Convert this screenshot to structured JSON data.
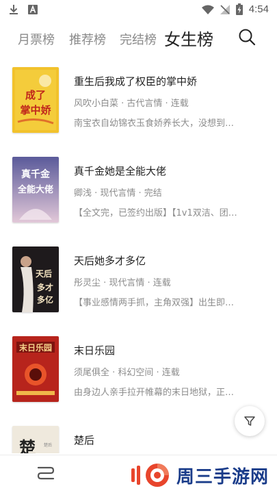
{
  "status_bar": {
    "time": "4:54",
    "icons": [
      "download-icon",
      "font-app-icon",
      "wifi-icon",
      "no-signal-icon",
      "battery-charging-icon"
    ]
  },
  "tabs": [
    {
      "label": "月票榜",
      "active": false
    },
    {
      "label": "推荐榜",
      "active": false
    },
    {
      "label": "完结榜",
      "active": false
    },
    {
      "label": "女生榜",
      "active": true
    }
  ],
  "books": [
    {
      "title": "重生后我成了权臣的掌中娇",
      "meta": "风吹小白菜 · 古代言情 · 连载",
      "desc": "南宝衣自幼锦衣玉食娇养长大，没想到…",
      "cover_text": "我成了掌中娇",
      "cover_color": "#f2c22c"
    },
    {
      "title": "真千金她是全能大佬",
      "meta": "卿浅 · 现代言情 · 完结",
      "desc": "【全文完，已签约出版】【1v1双洁、团…",
      "cover_text": "真千金全能大佬",
      "cover_color": "#8c86b8"
    },
    {
      "title": "天后她多才多亿",
      "meta": "彤灵尘 · 现代言情 · 连载",
      "desc": "【事业感情两手抓，主角双强】出生即…",
      "cover_text": "天后她多才多亿",
      "cover_color": "#1e1a1c"
    },
    {
      "title": "末日乐园",
      "meta": "须尾俱全 · 科幻空间 · 连载",
      "desc": "由身边人亲手拉开帷幕的末日地狱，正…",
      "cover_text": "末日乐园",
      "cover_color": "#b7241c"
    },
    {
      "title": "楚后",
      "meta": "",
      "desc": "",
      "cover_text": "楚",
      "cover_color": "#efe9dd"
    }
  ],
  "bottom_bar": {
    "watermark_text": "周三手游网",
    "watermark_color": "#1a3c8a",
    "accent_color": "#e8452c"
  }
}
